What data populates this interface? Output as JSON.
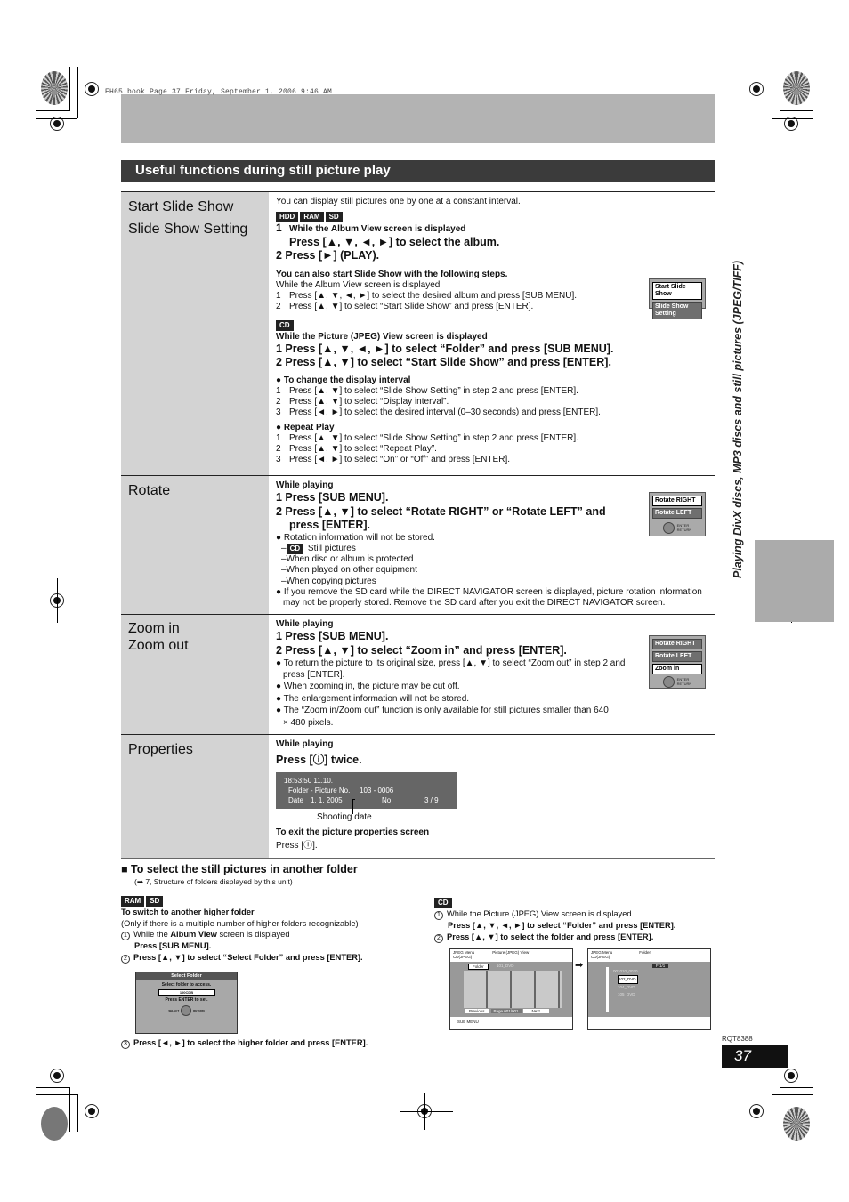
{
  "header": {
    "book_line": "EH65.book  Page 37  Friday, September 1, 2006  9:46 AM"
  },
  "section": {
    "title": "Useful functions during still picture play"
  },
  "side_tab": {
    "text": "Playing DivX discs, MP3 discs and still pictures (JPEG/TIFF)"
  },
  "slideshow": {
    "heading1": "Start Slide Show",
    "heading2": "Slide Show Setting",
    "intro": "You can display still pictures one by one at a constant interval.",
    "badges1": [
      "HDD",
      "RAM",
      "SD"
    ],
    "step1_num": "1",
    "step1_small": "While the Album View screen is displayed",
    "step1_large": "Press [▲, ▼, ◄, ►] to select the album.",
    "step2": "2  Press [►] (PLAY).",
    "also_title": "You can also start Slide Show with the following steps.",
    "also_sub": "While the Album View screen is displayed",
    "also_steps": [
      {
        "n": "1",
        "t": "Press [▲, ▼, ◄, ►] to select the desired album and press [SUB MENU]."
      },
      {
        "n": "2",
        "t": "Press [▲, ▼] to select “Start Slide Show” and press [ENTER]."
      }
    ],
    "menu": {
      "items": [
        "Start Slide Show",
        "Slide Show Setting"
      ],
      "selected": 0
    },
    "badge_cd": "CD",
    "cd_sub": "While the Picture (JPEG) View screen is displayed",
    "cd_steps": [
      "1  Press [▲, ▼, ◄, ►] to select “Folder” and press [SUB MENU].",
      "2  Press [▲, ▼] to select “Start Slide Show” and press [ENTER]."
    ],
    "interval_title": "To change the display interval",
    "interval_steps": [
      {
        "n": "1",
        "t": "Press [▲, ▼] to select “Slide Show Setting” in step 2 and press [ENTER]."
      },
      {
        "n": "2",
        "t": "Press [▲, ▼] to select “Display interval”."
      },
      {
        "n": "3",
        "t": "Press [◄, ►] to select the desired interval (0–30 seconds) and press [ENTER]."
      }
    ],
    "repeat_title": "Repeat Play",
    "repeat_steps": [
      {
        "n": "1",
        "t": "Press [▲, ▼] to select “Slide Show Setting” in step 2 and press [ENTER]."
      },
      {
        "n": "2",
        "t": "Press [▲, ▼] to select “Repeat Play”."
      },
      {
        "n": "3",
        "t": "Press [◄, ►] to select “On” or “Off” and press [ENTER]."
      }
    ]
  },
  "rotate": {
    "heading": "Rotate",
    "sub": "While playing",
    "step1": "1  Press [SUB MENU].",
    "step2a": "2  Press [▲, ▼] to select “Rotate RIGHT” or “Rotate LEFT” and",
    "step2b": "press [ENTER].",
    "note1": "Rotation information will not be stored.",
    "cd_badge": "CD",
    "cd_text": "Still pictures",
    "dashes": [
      "–When disc or album is protected",
      "–When played on other equipment",
      "–When copying pictures"
    ],
    "note2": "If you remove the SD card while the DIRECT NAVIGATOR screen is displayed, picture rotation information may not be properly stored. Remove the SD card after you exit the DIRECT NAVIGATOR screen.",
    "menu": {
      "items": [
        "Rotate RIGHT",
        "Rotate LEFT"
      ],
      "nav_enter": "ENTER",
      "nav_return": "RETURN"
    }
  },
  "zoom": {
    "heading1": "Zoom in",
    "heading2": "Zoom out",
    "sub": "While playing",
    "step1": "1  Press [SUB MENU].",
    "step2": "2  Press [▲, ▼] to select “Zoom in” and press [ENTER].",
    "notes": [
      "To return the picture to its original size, press [▲, ▼] to select “Zoom out” in step 2 and press [ENTER].",
      "When zooming in, the picture may be cut off.",
      "The enlargement information will not be stored.",
      "The “Zoom in/Zoom out” function is only available for still pictures smaller than 640 × 480 pixels."
    ],
    "menu": {
      "items": [
        "Rotate RIGHT",
        "Rotate LEFT",
        "Zoom in"
      ],
      "nav_enter": "ENTER",
      "nav_return": "RETURN"
    }
  },
  "properties": {
    "heading": "Properties",
    "sub": "While playing",
    "step": "Press [ⓘ] twice.",
    "display": {
      "time": "18:53:50 11.10.",
      "folder_label": "Folder - Picture No.",
      "folder_value": "103 - 0006",
      "date_label": "Date",
      "date_value": "1. 1. 2005",
      "no_label": "No.",
      "no_value": "3 / 9"
    },
    "callout": "Shooting date",
    "exit_title": "To exit the picture properties screen",
    "exit_text": "Press [ⓘ]."
  },
  "another_folder": {
    "title": "To select the still pictures in another folder",
    "ref": "(➡ 7, Structure of folders displayed by this unit)",
    "left": {
      "badges": [
        "RAM",
        "SD"
      ],
      "title": "To switch to another higher folder",
      "note": "(Only if there is a multiple number of higher folders recognizable)",
      "s1_num": "1",
      "s1_pre": "While the ",
      "s1_bold": "Album View",
      "s1_post": " screen is displayed",
      "s1_line2": "Press [SUB MENU].",
      "s2_num": "2",
      "s2": "Press [▲, ▼] to select “Select Folder” and press [ENTER].",
      "s3_num": "3",
      "s3": "Press [◄, ►] to select the higher folder and press [ENTER].",
      "screen": {
        "title": "Select Folder",
        "prompt": "Select folder to access.",
        "value": "100CDB",
        "hint": "Press ENTER to set.",
        "nav_select": "SELECT",
        "nav_enter": "ENTER",
        "nav_return": "RETURN"
      }
    },
    "right": {
      "badge": "CD",
      "s1_num": "1",
      "s1": "While the Picture (JPEG) View screen is displayed",
      "s1_line2": "Press [▲, ▼, ◄, ►] to select “Folder” and press [ENTER].",
      "s2_num": "2",
      "s2": "Press [▲, ▼] to select the folder and press [ENTER].",
      "screen1": {
        "menu": "JPEG Menu",
        "src": "CD(JPEG)",
        "title": "Picture (JPEG) View",
        "folder_btn": "Folder",
        "folder_name": "101_DVD",
        "prev": "Previous",
        "page": "Page 001/001",
        "next": "Next",
        "sub_menu": "SUB MENU"
      },
      "screen2": {
        "menu": "JPEG Menu",
        "src": "CD(JPEG)",
        "title": "Folder",
        "page": "F 1/1",
        "folders": [
          "001010_0020",
          "102_DVD",
          "104_DVD",
          "105_DVD"
        ]
      }
    }
  },
  "footer": {
    "code": "RQT8388",
    "page": "37"
  }
}
